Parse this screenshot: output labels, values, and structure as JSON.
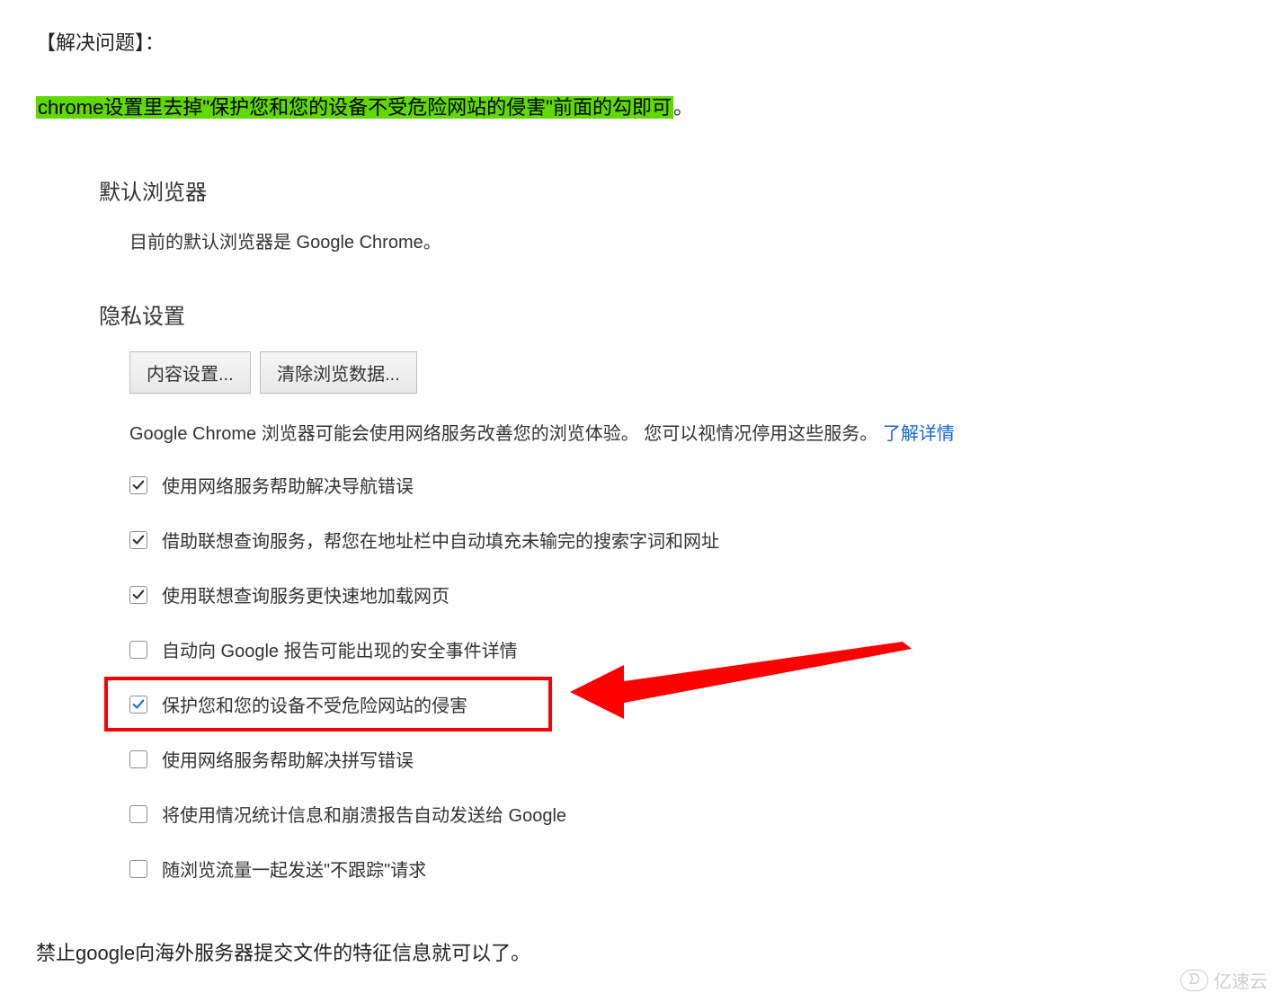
{
  "intro": {
    "title": "【解决问题】：",
    "highlight_text": "chrome设置里去掉\"保护您和您的设备不受危险网站的侵害\"前面的勾即可",
    "highlight_suffix": "。"
  },
  "settings": {
    "default_browser_heading": "默认浏览器",
    "default_browser_text": "目前的默认浏览器是 Google Chrome。",
    "privacy_heading": "隐私设置",
    "buttons": {
      "content": "内容设置...",
      "clear": "清除浏览数据..."
    },
    "description": "Google Chrome 浏览器可能会使用网络服务改善您的浏览体验。 您可以视情况停用这些服务。 ",
    "learn_more": "了解详情",
    "options": [
      {
        "label": "使用网络服务帮助解决导航错误",
        "checked": true,
        "style": "black"
      },
      {
        "label": "借助联想查询服务，帮您在地址栏中自动填充未输完的搜索字词和网址",
        "checked": true,
        "style": "black"
      },
      {
        "label": "使用联想查询服务更快速地加载网页",
        "checked": true,
        "style": "black"
      },
      {
        "label": "自动向 Google 报告可能出现的安全事件详情",
        "checked": false,
        "style": "black"
      },
      {
        "label": "保护您和您的设备不受危险网站的侵害",
        "checked": true,
        "style": "blue"
      },
      {
        "label": "使用网络服务帮助解决拼写错误",
        "checked": false,
        "style": "black"
      },
      {
        "label": "将使用情况统计信息和崩溃报告自动发送给 Google",
        "checked": false,
        "style": "black"
      },
      {
        "label": "随浏览流量一起发送\"不跟踪\"请求",
        "checked": false,
        "style": "black"
      }
    ]
  },
  "footer": {
    "text": "禁止google向海外服务器提交文件的特征信息就可以了。"
  },
  "watermark": {
    "icon": "ᗤ",
    "text": "亿速云"
  },
  "annotation": {
    "highlighted_option_index": 4
  }
}
